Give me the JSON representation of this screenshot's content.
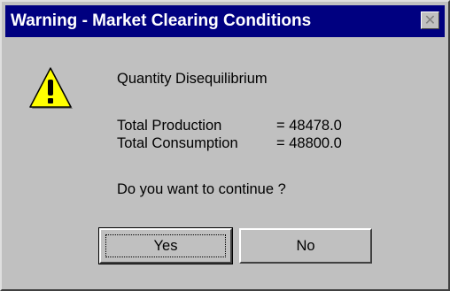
{
  "window": {
    "title": "Warning - Market Clearing Conditions",
    "close_glyph": "✕"
  },
  "icon": {
    "name": "warning-icon",
    "fill": "#ffff00",
    "mark": "!"
  },
  "message": {
    "heading": "Quantity Disequilibrium",
    "rows": [
      {
        "label": "Total Production",
        "value": "= 48478.0"
      },
      {
        "label": "Total Consumption",
        "value": "= 48800.0"
      }
    ],
    "question": "Do you want to continue ?"
  },
  "buttons": {
    "yes": "Yes",
    "no": "No"
  }
}
